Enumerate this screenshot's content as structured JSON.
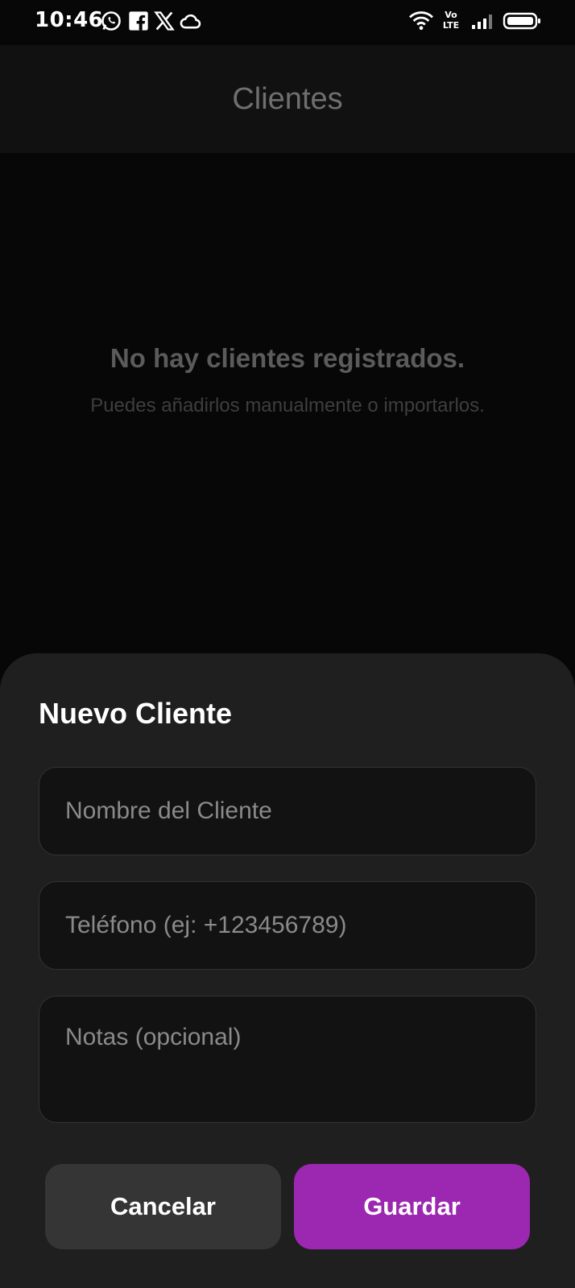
{
  "status_bar": {
    "time": "10:46",
    "notification_icons": [
      "whatsapp-icon",
      "facebook-icon",
      "x-icon",
      "cloud-icon"
    ],
    "network_label_top": "Vo",
    "network_label_bottom": "LTE",
    "system_icons": [
      "wifi-icon",
      "volte-icon",
      "signal-icon",
      "battery-icon"
    ]
  },
  "appbar": {
    "title": "Clientes"
  },
  "empty_state": {
    "title": "No hay clientes registrados.",
    "subtitle": "Puedes añadirlos manualmente o importarlos."
  },
  "sheet": {
    "title": "Nuevo Cliente",
    "name_field": {
      "placeholder": "Nombre del Cliente",
      "value": ""
    },
    "phone_field": {
      "placeholder": "Teléfono (ej: +123456789)",
      "value": ""
    },
    "notes_field": {
      "placeholder": "Notas (opcional)",
      "value": ""
    },
    "cancel_label": "Cancelar",
    "save_label": "Guardar"
  },
  "colors": {
    "accent": "#9c27b0",
    "sheet_bg": "#1f1f1f",
    "background": "#070707"
  }
}
